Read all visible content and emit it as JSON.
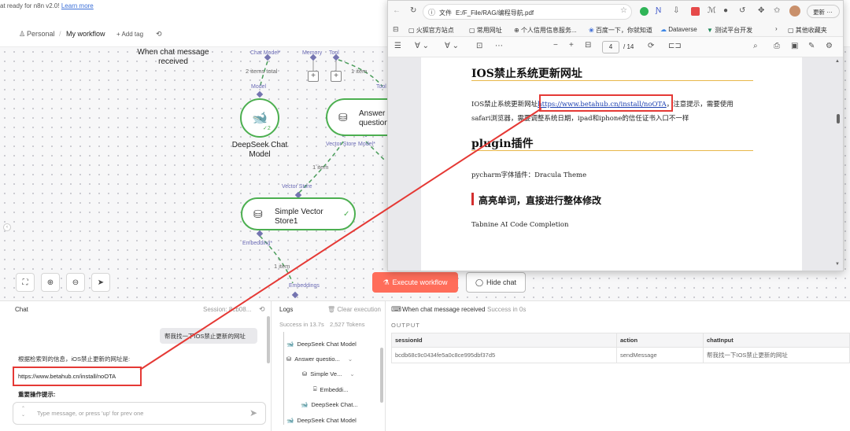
{
  "banner": {
    "text": "at ready for n8n v2.0!",
    "link": "Learn more"
  },
  "header": {
    "personal": "Personal",
    "separator": "/",
    "workflow_name": "My workflow",
    "add_tag": "+ Add tag"
  },
  "canvas": {
    "trigger_label": "When chat message received",
    "agent_ports": {
      "chat_model": "Chat Model*",
      "memory": "Memory",
      "tool": "Tool"
    },
    "items_total": "2 items total",
    "one_item_a": "1 item",
    "one_item_b": "1 item",
    "one_item_c": "1 item",
    "model_port": "Model",
    "tool_port": "Tool",
    "deepseek_node": {
      "title": "DeepSeek Chat Model",
      "badge": "2"
    },
    "answer_node": {
      "title": "Answer question"
    },
    "answer_ports": {
      "vector_store": "Vector Store",
      "model": "Model*"
    },
    "vector_store_port": "Vector Store",
    "vector_node": {
      "title": "Simple Vector Store1"
    },
    "embedding_port": "Embedding*",
    "embeddings_port": "Embeddings",
    "execute_button": "Execute workflow",
    "hide_chat_button": "Hide chat"
  },
  "chat": {
    "title": "Chat",
    "session": "Session: 8cb08...",
    "user_message": "帮我找一下IOS禁止更新的网址",
    "bot_intro": "根据检索到的信息，iOS禁止更新的网址是:",
    "bot_url": "https://www.betahub.cn/install/noOTA",
    "bot_note": "重要操作提示:",
    "input_placeholder": "Type message, or press 'up' for prev one"
  },
  "logs": {
    "title": "Logs",
    "clear": "Clear execution",
    "status": "Success in 13.7s",
    "tokens": "2,527 Tokens",
    "rows": [
      "DeepSeek Chat Model",
      "Answer questio...",
      "Simple Ve...",
      "Embeddi...",
      "DeepSeek Chat...",
      "DeepSeek Chat Model"
    ]
  },
  "output": {
    "node_name": "When chat message received",
    "status": "Success in 0s",
    "label": "OUTPUT",
    "columns": [
      "sessionId",
      "action",
      "chatInput"
    ],
    "row": [
      "bcdb68c9c0434fe5a0c8ce995dbf37d5",
      "sendMessage",
      "帮我找一下IOS禁止更新的网址"
    ]
  },
  "browser": {
    "file_label": "文件",
    "address": "E:/F_File/RAG/编程导航.pdf",
    "update_button": "更新",
    "bookmarks": [
      "火狐官方站点",
      "常用网址",
      "个人信用信息服务...",
      "百度一下，你就知道",
      "Dataverse",
      "测试平台开发"
    ],
    "other_bookmarks": "其他收藏夹",
    "page_current": "4",
    "page_total": "/ 14"
  },
  "pdf": {
    "h1": "IOS禁止系统更新网址",
    "p1_prefix": "IOS禁止系统更新网址",
    "p1_link": "https://www.betahub.cn/install/noOTA",
    "p1_suffix": "，注意提示，需要使用",
    "p2": "safari浏览器，需要调整系统日期，ipad和iphone的信任证书入口不一样",
    "h2": "plugin插件",
    "p3": "pycharm字体插件：Dracula Theme",
    "h3": "高亮单词，直接进行整体修改",
    "p4": "Tabnine AI Code Completion"
  },
  "colors": {
    "accent": "#ff6d5a",
    "node_green": "#4caf50",
    "highlight": "#e53935",
    "port": "#7474b0"
  }
}
